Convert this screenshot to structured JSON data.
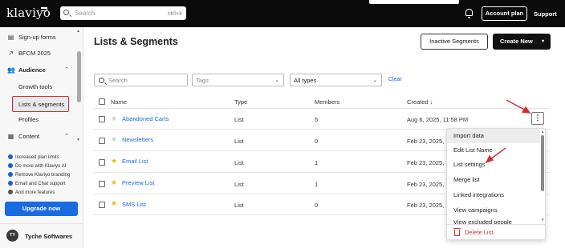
{
  "app": {
    "logo_text": "klaviyo"
  },
  "topbar": {
    "search_placeholder": "Search",
    "search_shortcut": "ctrl+k",
    "account_plan_label": "Account plan",
    "support_label": "Support"
  },
  "sidebar": {
    "items": [
      {
        "label": "Sign-up forms",
        "icon": "form-icon"
      },
      {
        "label": "BFCM 2025",
        "icon": "trend-icon"
      },
      {
        "label": "Audience",
        "icon": "people-icon",
        "expanded": true
      },
      {
        "label": "Growth tools"
      },
      {
        "label": "Lists & segments",
        "active": true
      },
      {
        "label": "Profiles"
      },
      {
        "label": "Content",
        "icon": "content-icon",
        "expanded": true
      }
    ],
    "promos": [
      "Increased plan limits",
      "Do more with Klaviyo AI",
      "Remove Klaviyo branding",
      "Email and Chat support",
      "And more features"
    ],
    "upgrade_label": "Upgrade now",
    "user": {
      "initials": "TY",
      "name": "Tyche Softwares"
    }
  },
  "main": {
    "title": "Lists & Segments",
    "inactive_segments_label": "Inactive Segments",
    "create_new_label": "Create New",
    "filters": {
      "search_placeholder": "Search",
      "tags_placeholder": "Tags",
      "type_value": "All types",
      "clear_label": "Clear"
    },
    "table": {
      "headers": {
        "name": "Name",
        "type": "Type",
        "members": "Members",
        "created": "Created ↓"
      },
      "rows": [
        {
          "name": "Abandoned Carts",
          "type": "List",
          "members": "5",
          "created": "Aug 6, 2025, 11:58 PM",
          "starred": false
        },
        {
          "name": "Newsletters",
          "type": "List",
          "members": "0",
          "created": "Feb 23, 2025, 3:",
          "starred": false
        },
        {
          "name": "Email List",
          "type": "List",
          "members": "1",
          "created": "Feb 23, 2025, 3:",
          "starred": true
        },
        {
          "name": "Preview List",
          "type": "List",
          "members": "1",
          "created": "Feb 23, 2025, 3:",
          "starred": true
        },
        {
          "name": "SMS List",
          "type": "List",
          "members": "0",
          "created": "Feb 23, 2025, 3:",
          "starred": true
        }
      ]
    }
  },
  "row_menu": {
    "items": [
      "Import data",
      "Edit List Name",
      "List settings",
      "Merge list",
      "Linked integrations",
      "View campaigns",
      "View excluded people"
    ],
    "delete_label": "Delete List"
  },
  "colors": {
    "accent": "#1a6ae0",
    "annotation_red": "#d32f2f",
    "topbar": "#0b0b0b",
    "star": "#f5b800"
  }
}
